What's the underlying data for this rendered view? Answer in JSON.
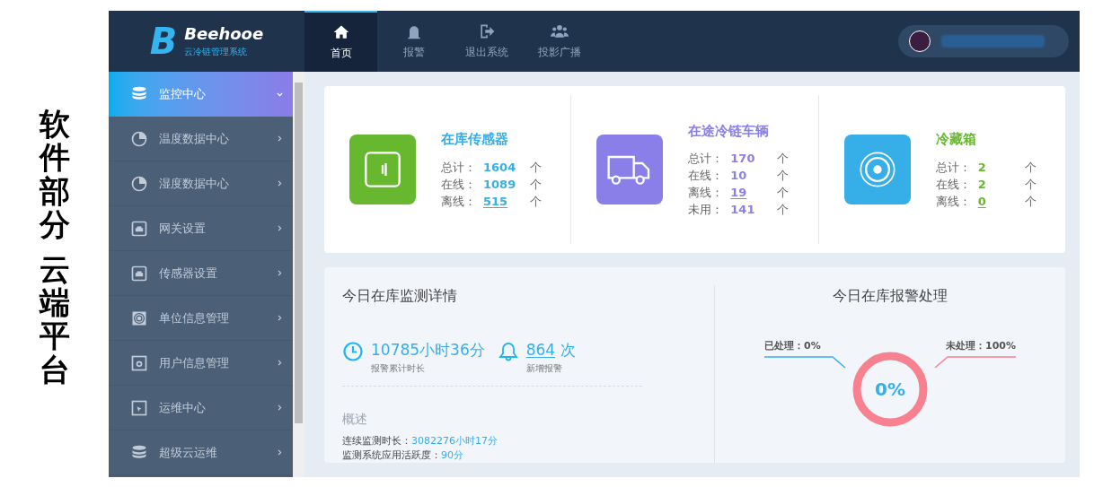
{
  "slide_label": {
    "lines": [
      "软件部分",
      "云端平台"
    ]
  },
  "logo": {
    "letter": "B",
    "name": "Beehooe",
    "subtitle": "云冷链管理系统"
  },
  "nav_tabs": [
    {
      "label": "首页",
      "selected": true
    },
    {
      "label": "报警",
      "selected": false
    },
    {
      "label": "退出系统",
      "selected": false
    },
    {
      "label": "投影广播",
      "selected": false
    }
  ],
  "sidebar": {
    "items": [
      {
        "label": "监控中心",
        "selected": true
      },
      {
        "label": "温度数据中心",
        "selected": false
      },
      {
        "label": "湿度数据中心",
        "selected": false
      },
      {
        "label": "网关设置",
        "selected": false
      },
      {
        "label": "传感器设置",
        "selected": false
      },
      {
        "label": "单位信息管理",
        "selected": false
      },
      {
        "label": "用户信息管理",
        "selected": false
      },
      {
        "label": "运维中心",
        "selected": false
      },
      {
        "label": "超级云运维",
        "selected": false
      }
    ]
  },
  "summary_cards": [
    {
      "kind": "fridge",
      "title": "在库传感器",
      "icon_tile": {
        "color": "#67b72f"
      },
      "color": "#36aee8",
      "stats": [
        {
          "label": "总计：",
          "value": "1604",
          "unit": "个",
          "link": false
        },
        {
          "label": "在线：",
          "value": "1089",
          "unit": "个",
          "link": false
        },
        {
          "label": "离线：",
          "value": "515",
          "unit": "个",
          "link": true
        }
      ]
    },
    {
      "kind": "truck",
      "title": "在途冷链车辆",
      "icon_tile": {
        "color": "#8a7fe8"
      },
      "color": "#8a7fe8",
      "stats": [
        {
          "label": "总计：",
          "value": "170",
          "unit": "个",
          "link": false
        },
        {
          "label": "在线：",
          "value": "10",
          "unit": "个",
          "link": false
        },
        {
          "label": "离线：",
          "value": "19",
          "unit": "个",
          "link": true
        },
        {
          "label": "未用：",
          "value": "141",
          "unit": "个",
          "link": false
        }
      ]
    },
    {
      "kind": "target",
      "title": "冷藏箱",
      "icon_tile": {
        "color": "#36aee8"
      },
      "color": "#67b72f",
      "stats": [
        {
          "label": "总计：",
          "value": "2",
          "unit": "个",
          "link": false
        },
        {
          "label": "在线：",
          "value": "2",
          "unit": "个",
          "link": false
        },
        {
          "label": "离线：",
          "value": "0",
          "unit": "个",
          "link": true
        }
      ]
    }
  ],
  "monitor_panel": {
    "title": "今日在库监测详情",
    "metrics": [
      {
        "kind": "clock",
        "value": "10785小时36分",
        "caption": "报警累计时长",
        "link": false
      },
      {
        "kind": "bell",
        "value": "864",
        "unit": "次",
        "caption": "新增报警",
        "link": true
      }
    ],
    "overview_title": "概述",
    "overview_lines": [
      {
        "label": "连续监测时长：",
        "value": "3082276小时17分"
      },
      {
        "label": "监测系统应用活跃度：",
        "value": "90分"
      }
    ]
  },
  "alarm_panel": {
    "title": "今日在库报警处理",
    "center_label": "0%",
    "legend_labels": [
      {
        "text": "已处理：0%",
        "color": "#36aee8"
      },
      {
        "text": "未处理：100%",
        "color": "#f7818f"
      }
    ]
  }
}
